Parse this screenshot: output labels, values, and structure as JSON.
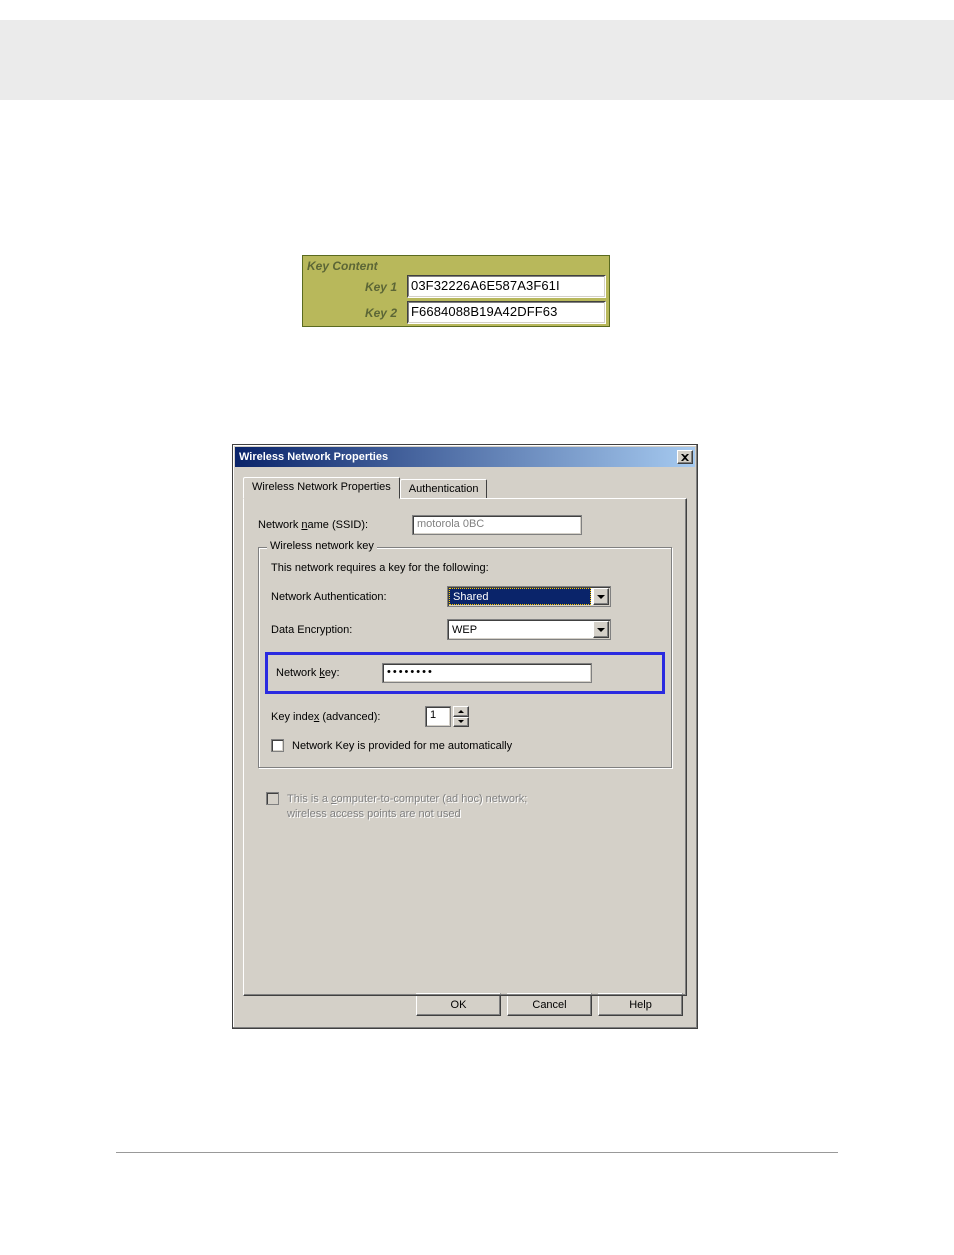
{
  "keyTable": {
    "header": "Key Content",
    "rows": [
      {
        "label": "Key 1",
        "value": "03F32226A6E587A3F61I"
      },
      {
        "label": "Key 2",
        "value": "F6684088B19A42DFF63"
      }
    ]
  },
  "dialog": {
    "title": "Wireless Network Properties",
    "tabs": {
      "active": "Wireless Network Properties",
      "inactive": "Authentication"
    },
    "ssid": {
      "label_pre": "Network ",
      "label_u": "n",
      "label_post": "ame (SSID):",
      "value": "motorola 0BC"
    },
    "group": {
      "title": "Wireless network key",
      "info": "This network requires a key for the following:",
      "auth": {
        "label": "Network Authentication:",
        "value": "Shared"
      },
      "enc": {
        "label": "Data Encryption:",
        "value": "WEP"
      },
      "key": {
        "label_pre": "Network ",
        "label_u": "k",
        "label_post": "ey:",
        "value": "••••••••"
      },
      "index": {
        "label_pre": "Key inde",
        "label_u": "x",
        "label_post": " (advanced):",
        "value": "1"
      },
      "autoKey": {
        "label": "Network Key is provided for me automatically"
      }
    },
    "adhoc": {
      "label_pre": "This is a ",
      "label_u": "c",
      "label_post": "omputer-to-computer (ad hoc) network;",
      "label_line2": "wireless access points are not used"
    },
    "buttons": {
      "ok": "OK",
      "cancel": "Cancel",
      "help": "Help"
    }
  }
}
